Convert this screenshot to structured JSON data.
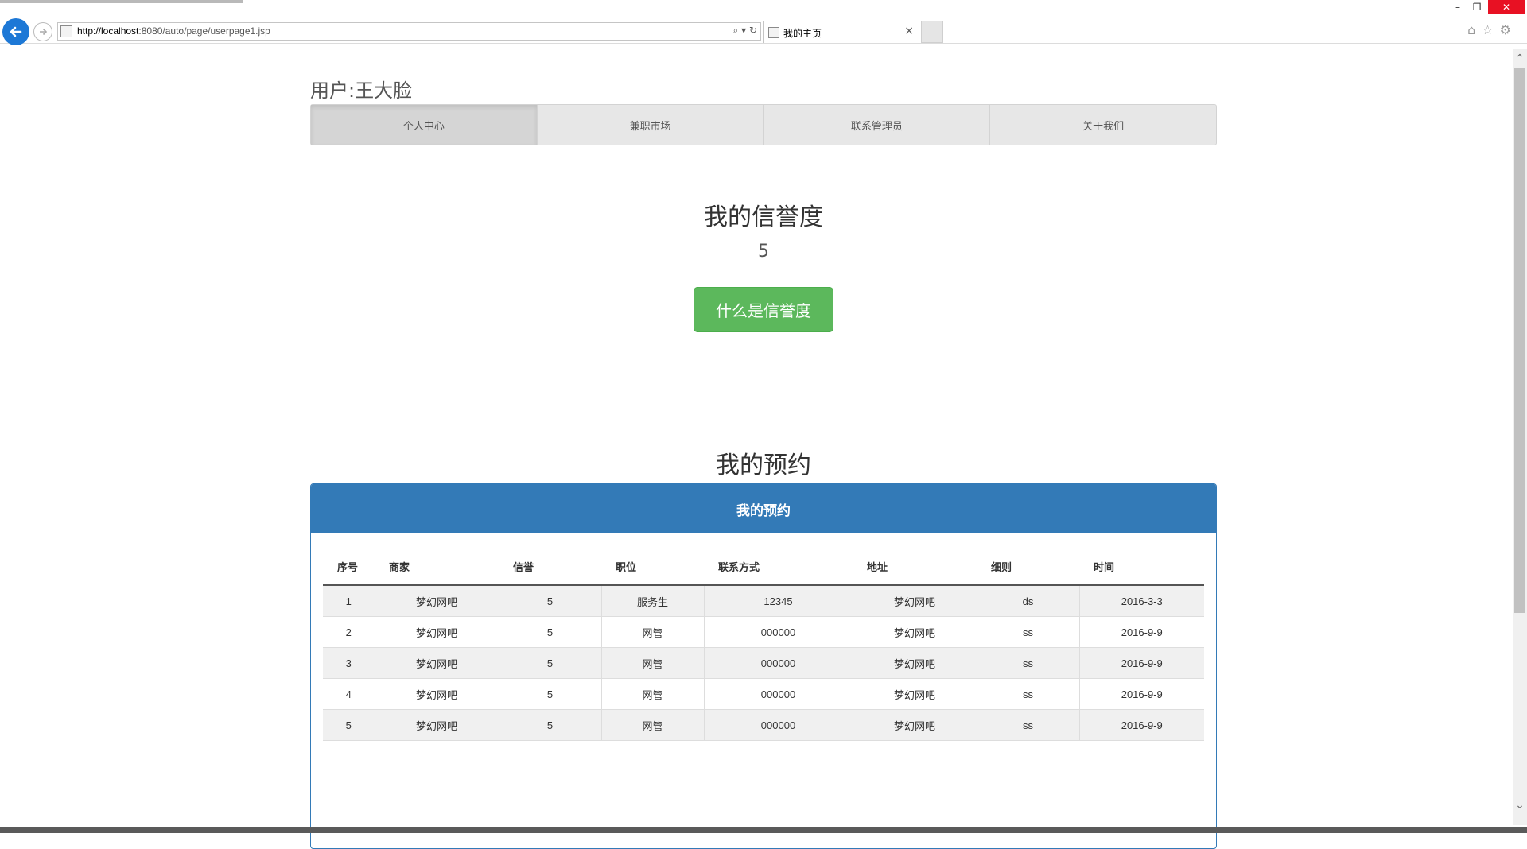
{
  "browser": {
    "url_host": "http://localhost",
    "url_rest": ":8080/auto/page/userpage1.jsp",
    "tab_title": "我的主页"
  },
  "page": {
    "user_title": "用户:王大脸",
    "nav": [
      "个人中心",
      "兼职市场",
      "联系管理员",
      "关于我们"
    ],
    "credit_title": "我的信誉度",
    "credit_value": "5",
    "credit_button": "什么是信誉度",
    "booking_title": "我的预约",
    "panel_heading": "我的预约"
  },
  "table": {
    "headers": [
      "序号",
      "商家",
      "信誉",
      "职位",
      "联系方式",
      "地址",
      "细则",
      "时间"
    ],
    "rows": [
      [
        "1",
        "梦幻网吧",
        "5",
        "服务生",
        "12345",
        "梦幻网吧",
        "ds",
        "2016-3-3"
      ],
      [
        "2",
        "梦幻网吧",
        "5",
        "网管",
        "000000",
        "梦幻网吧",
        "ss",
        "2016-9-9"
      ],
      [
        "3",
        "梦幻网吧",
        "5",
        "网管",
        "000000",
        "梦幻网吧",
        "ss",
        "2016-9-9"
      ],
      [
        "4",
        "梦幻网吧",
        "5",
        "网管",
        "000000",
        "梦幻网吧",
        "ss",
        "2016-9-9"
      ],
      [
        "5",
        "梦幻网吧",
        "5",
        "网管",
        "000000",
        "梦幻网吧",
        "ss",
        "2016-9-9"
      ]
    ]
  },
  "colors": {
    "primary": "#337ab7",
    "success": "#5cb85c"
  }
}
